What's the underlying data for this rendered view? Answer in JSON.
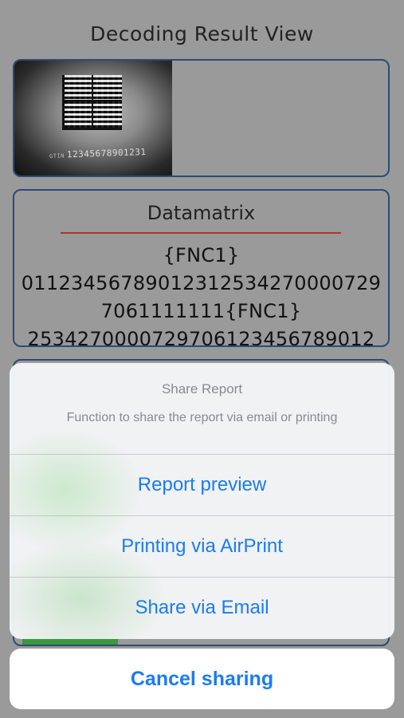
{
  "page": {
    "title": "Decoding Result View"
  },
  "image_panel": {
    "caption_prefix": "GTIN",
    "caption_number": "12345678901231"
  },
  "result": {
    "symbology": "Datamatrix",
    "lines": [
      "{FNC1}",
      "01123456789012312534270000729",
      "7061111111{FNC1}",
      "25342700007297061234567890​12"
    ]
  },
  "share_sheet": {
    "title": "Share Report",
    "message": "Function to share the report via email or printing",
    "actions": [
      "Report preview",
      "Printing via AirPrint",
      "Share via Email"
    ],
    "cancel": "Cancel sharing"
  },
  "colors": {
    "background": "#9a9a9a",
    "panel_border": "#2d4a78",
    "divider_red": "#b0352b",
    "ios_blue": "#1a7cf2"
  }
}
